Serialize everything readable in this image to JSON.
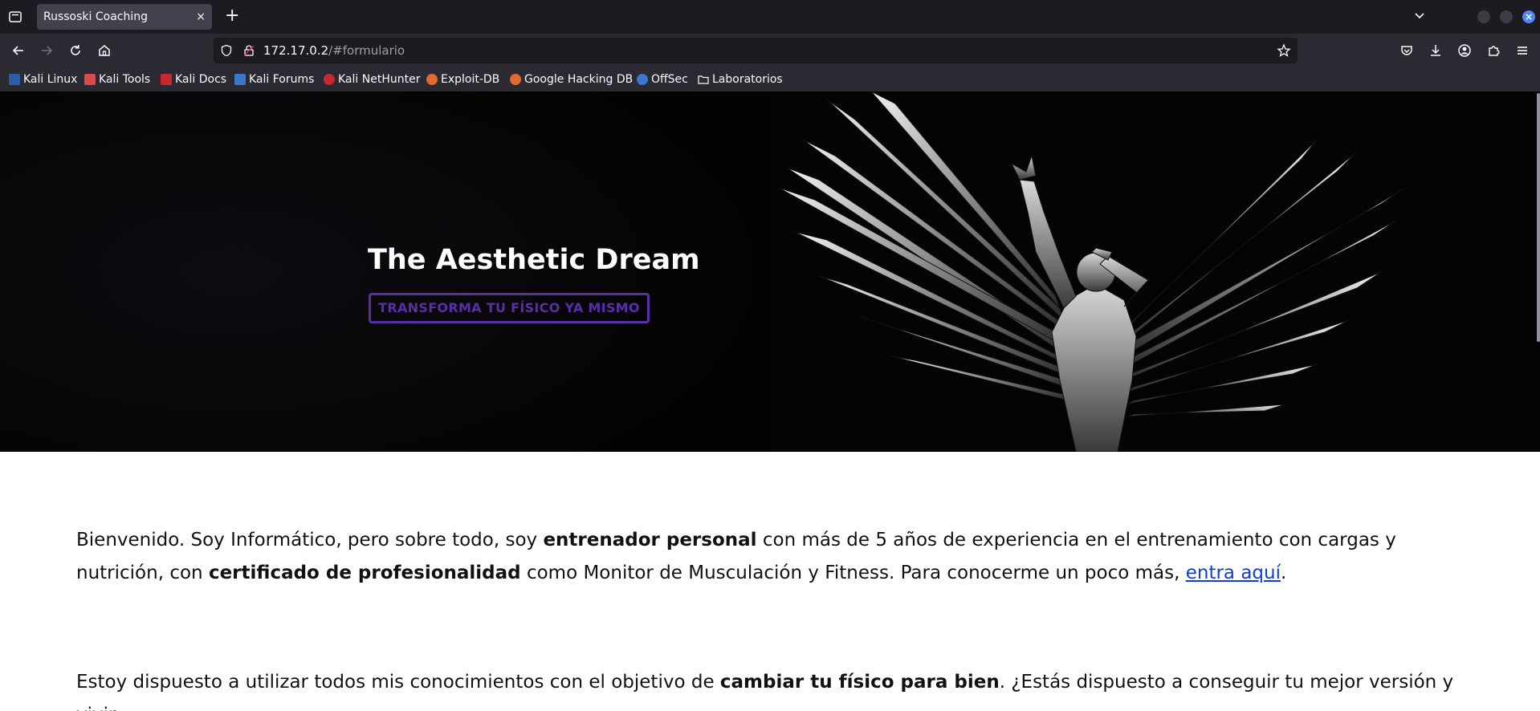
{
  "browser": {
    "tab_title": "Russoski Coaching",
    "tab_close": "×",
    "new_tab": "+",
    "window_close": "×",
    "url_host": "172.17.0.2",
    "url_path": "/#formulario"
  },
  "bookmarks": [
    {
      "label": "Kali Linux",
      "color": "#2a5fa8"
    },
    {
      "label": "Kali Tools",
      "color": "#d94b4b"
    },
    {
      "label": "Kali Docs",
      "color": "#c8272d"
    },
    {
      "label": "Kali Forums",
      "color": "#3a79c9"
    },
    {
      "label": "Kali NetHunter",
      "color": "#c8272d"
    },
    {
      "label": "Exploit-DB",
      "color": "#e06b2d"
    },
    {
      "label": "Google Hacking DB",
      "color": "#e06b2d"
    },
    {
      "label": "OffSec",
      "color": "#3a79c9"
    },
    {
      "label": "Laboratorios",
      "color": "folder"
    }
  ],
  "hero": {
    "title": "The Aesthetic Dream",
    "button": "TRANSFORMA TU FÍSICO YA MISMO",
    "accent": "#5a2ea6"
  },
  "content": {
    "p1_a": "Bienvenido. Soy Informático, pero sobre todo, soy ",
    "p1_b": "entrenador personal",
    "p1_c": " con más de 5 años de experiencia en el entrenamiento con cargas y nutrición, con ",
    "p1_d": "certificado de profesionalidad",
    "p1_e": " como Monitor de Musculación y Fitness. Para conocerme un poco más, ",
    "p1_link": "entra aquí",
    "p1_end": ".",
    "p2_a": "Estoy dispuesto a utilizar todos mis conocimientos con el objetivo de ",
    "p2_b": "cambiar tu físico para bien",
    "p2_c": ". ¿Estás dispuesto a conseguir tu mejor versión y vivir"
  }
}
